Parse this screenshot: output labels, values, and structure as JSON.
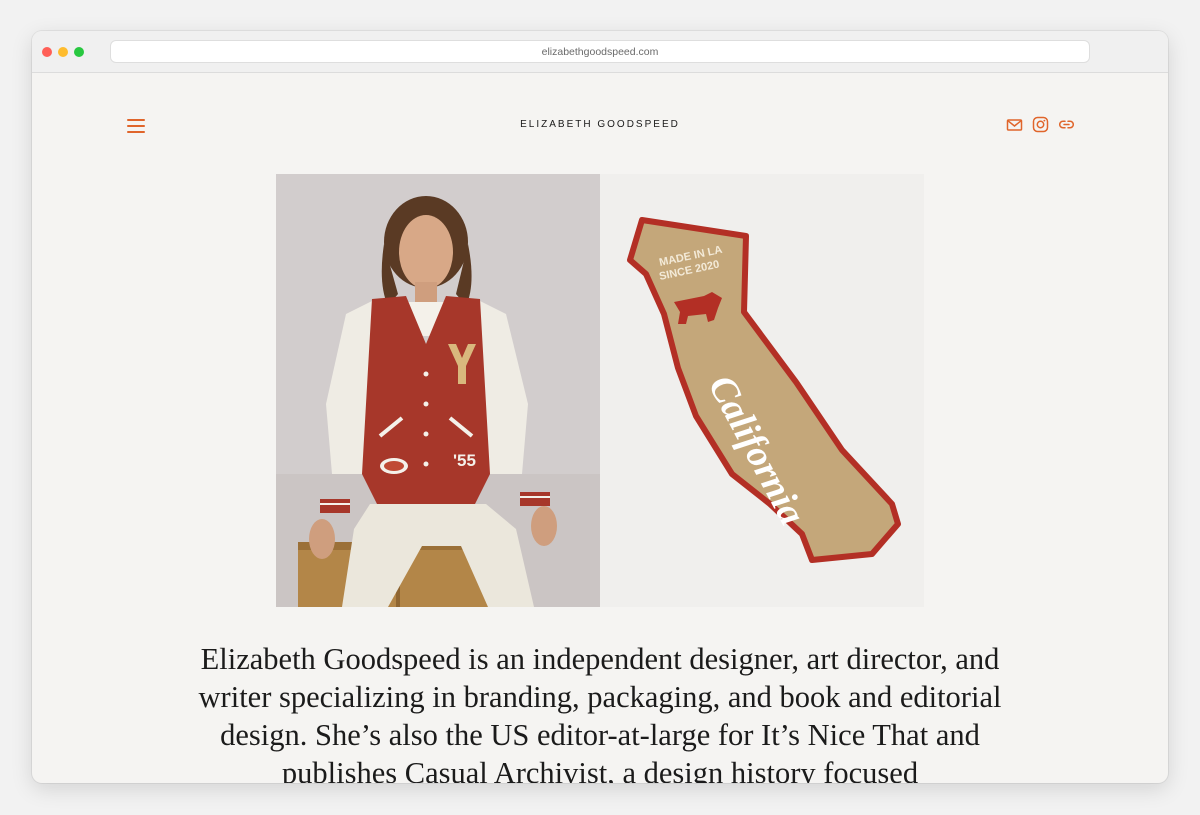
{
  "browser": {
    "url": "elizabethgoodspeed.com"
  },
  "header": {
    "site_title": "ELIZABETH GOODSPEED",
    "menu_icon": "hamburger-menu-icon",
    "social_icons": [
      "mail-icon",
      "instagram-icon",
      "link-icon"
    ]
  },
  "hero": {
    "left_image": "person-in-varsity-jacket-photo",
    "right_image": "california-embroidered-patch-photo",
    "patch_top_text": "MADE IN LA",
    "patch_year_text": "SINCE 2020",
    "patch_script": "California",
    "jacket_number": "'55"
  },
  "intro": {
    "text": "Elizabeth Goodspeed is an independent designer, art director, and writer specializing in branding, packaging, and book and editorial design. She’s also the US editor-at-large for It’s Nice That and publishes Casual Archivist, a design history focused"
  },
  "colors": {
    "accent": "#e0652b",
    "page_background": "#f5f4f2",
    "text": "#1b1b1b"
  }
}
